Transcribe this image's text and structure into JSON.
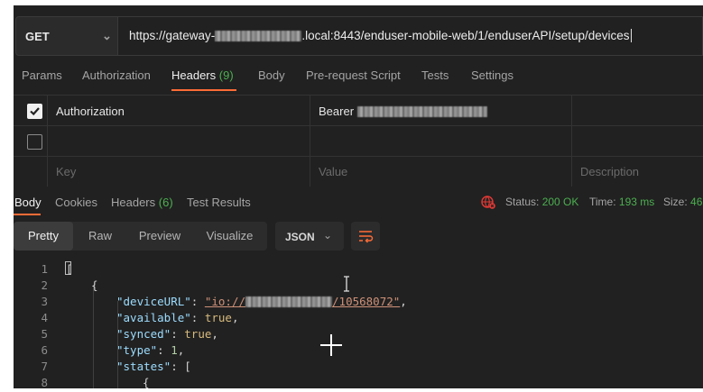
{
  "request": {
    "method": "GET",
    "url_prefix": "https://gateway-",
    "url_suffix": ".local:8443/enduser-mobile-web/1/enduserAPI/setup/devices"
  },
  "request_tabs": [
    {
      "label": "Params"
    },
    {
      "label": "Authorization"
    },
    {
      "label": "Headers",
      "count": "(9)"
    },
    {
      "label": "Body"
    },
    {
      "label": "Pre-request Script"
    },
    {
      "label": "Tests"
    },
    {
      "label": "Settings"
    }
  ],
  "headers_table": {
    "rows": [
      {
        "checked": true,
        "key": "Authorization",
        "value_prefix": "Bearer"
      },
      {
        "checked": false,
        "key": "",
        "value_prefix": ""
      }
    ],
    "placeholders": {
      "key": "Key",
      "value": "Value",
      "description": "Description"
    }
  },
  "response_tabs": [
    {
      "label": "Body"
    },
    {
      "label": "Cookies"
    },
    {
      "label": "Headers",
      "count": "(6)"
    },
    {
      "label": "Test Results"
    }
  ],
  "response_status": {
    "status_label": "Status:",
    "status_value": "200 OK",
    "time_label": "Time:",
    "time_value": "193 ms",
    "size_label": "Size:",
    "size_value": "46"
  },
  "view_modes": [
    "Pretty",
    "Raw",
    "Preview",
    "Visualize"
  ],
  "format": "JSON",
  "code_lines": [
    {
      "n": "1",
      "text": "["
    },
    {
      "n": "2",
      "text": "{"
    },
    {
      "n": "3",
      "key": "\"deviceURL\"",
      "val_prefix": "\"io://",
      "val_suffix": "/10568072\"",
      "tail": ","
    },
    {
      "n": "4",
      "key": "\"available\"",
      "val": "true",
      "tail": ","
    },
    {
      "n": "5",
      "key": "\"synced\"",
      "val": "true",
      "tail": ","
    },
    {
      "n": "6",
      "key": "\"type\"",
      "val": "1",
      "tail": ","
    },
    {
      "n": "7",
      "key": "\"states\"",
      "val": "[",
      "tail": ""
    },
    {
      "n": "8",
      "text": "{"
    }
  ],
  "colors": {
    "accent": "#ff6c37",
    "success": "#4caf50",
    "error_icon": "#e53935"
  }
}
